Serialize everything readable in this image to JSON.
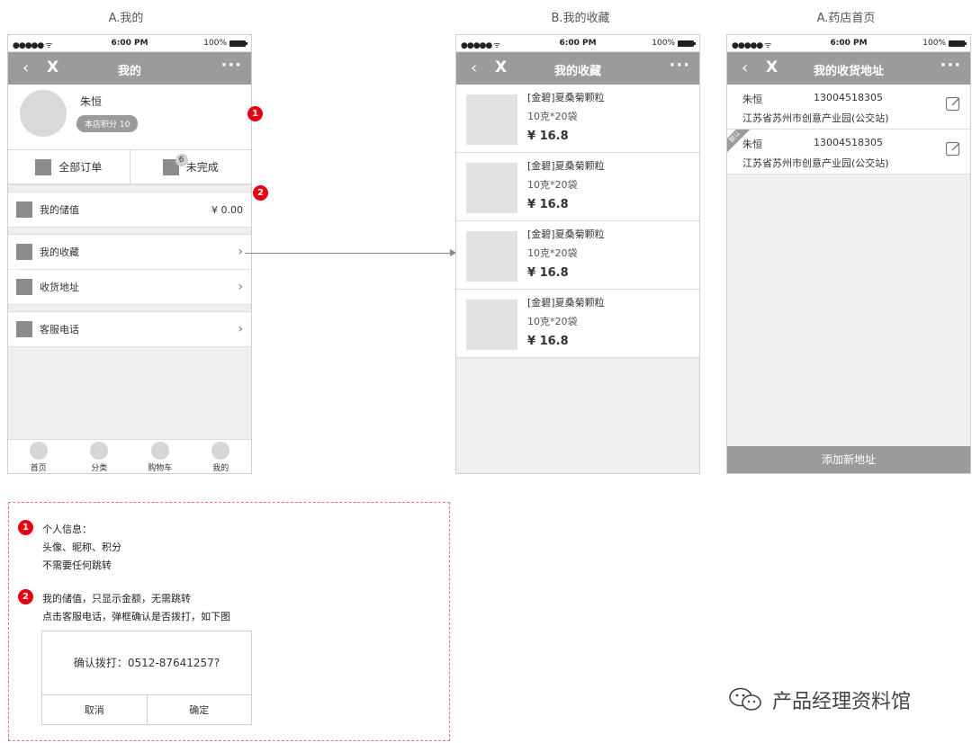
{
  "screen_titles": {
    "a": "A.我的",
    "b": "B.我的收藏",
    "c": "A.药店首页"
  },
  "status_bar": {
    "signal": "●●●●● ᯤ",
    "time": "6:00 PM",
    "battery": "100%"
  },
  "nav": {
    "back": "‹",
    "close": "X",
    "more": "···"
  },
  "screen_a": {
    "title": "我的",
    "name": "朱恒",
    "points_badge": "本店积分 10",
    "orders": [
      {
        "label": "全部订单"
      },
      {
        "label": "未完成",
        "count": "6"
      }
    ],
    "balance": {
      "label": "我的储值",
      "value": "¥ 0.00"
    },
    "rows": [
      {
        "label": "我的收藏"
      },
      {
        "label": "收货地址"
      }
    ],
    "service": {
      "label": "客服电话"
    },
    "chevron": "›",
    "tabs": [
      "首页",
      "分类",
      "购物车",
      "我的"
    ]
  },
  "screen_b": {
    "title": "我的收藏",
    "items": [
      {
        "name": "[金碧]夏桑菊颗粒",
        "spec": "10克*20袋",
        "price": "¥ 16.8"
      },
      {
        "name": "[金碧]夏桑菊颗粒",
        "spec": "10克*20袋",
        "price": "¥ 16.8"
      },
      {
        "name": "[金碧]夏桑菊颗粒",
        "spec": "10克*20袋",
        "price": "¥ 16.8"
      },
      {
        "name": "[金碧]夏桑菊颗粒",
        "spec": "10克*20袋",
        "price": "¥ 16.8"
      }
    ]
  },
  "screen_c": {
    "title": "我的收货地址",
    "addresses": [
      {
        "name": "朱恒",
        "phone": "13004518305",
        "address": "江苏省苏州市创意产业园(公交站)"
      },
      {
        "name": "朱恒",
        "phone": "13004518305",
        "address": "江苏省苏州市创意产业园(公交站)",
        "default_tag": "默认"
      }
    ],
    "add_button": "添加新地址"
  },
  "markers": {
    "one": "1",
    "two": "2"
  },
  "notes": {
    "n1_title": "个人信息：",
    "n1_line1": "头像、昵称、积分",
    "n1_line2": "不需要任何跳转",
    "n2_line1": "我的储值，只显示金额，无需跳转",
    "n2_line2": "点击客服电话，弹框确认是否拨打，如下图",
    "dialog_message": "确认拨打：0512-87641257?",
    "dialog_cancel": "取消",
    "dialog_confirm": "确定"
  },
  "watermark": "产品经理资料馆"
}
